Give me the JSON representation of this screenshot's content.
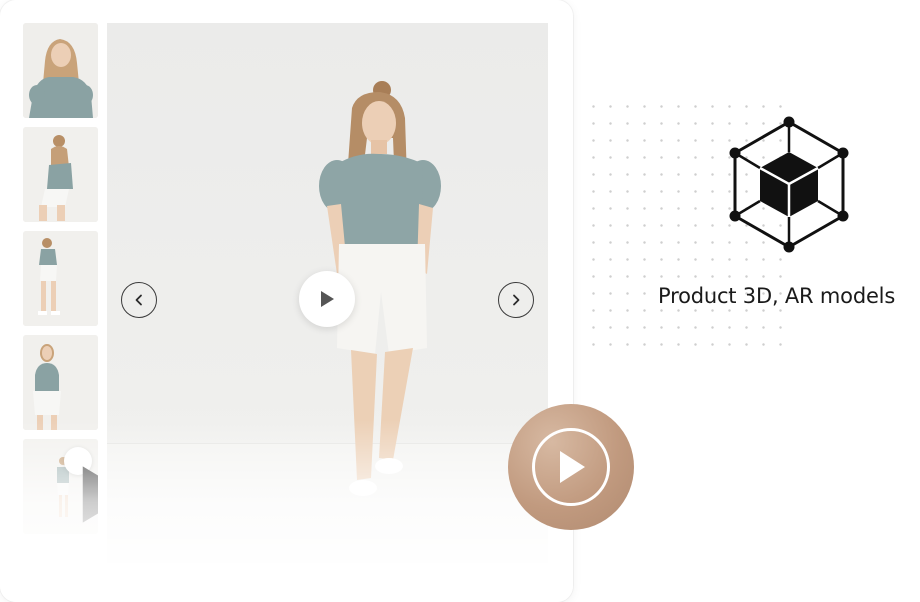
{
  "gallery": {
    "thumbnails": [
      {
        "label": "thumbnail-1",
        "type": "image"
      },
      {
        "label": "thumbnail-2",
        "type": "image"
      },
      {
        "label": "thumbnail-3",
        "type": "image"
      },
      {
        "label": "thumbnail-4",
        "type": "image"
      },
      {
        "label": "thumbnail-5",
        "type": "video"
      }
    ],
    "icons": {
      "prev": "chevron-left-icon",
      "next": "chevron-right-icon",
      "play": "play-icon"
    }
  },
  "feature": {
    "label": "Product 3D, AR models",
    "icon": "3d-cube-icon"
  },
  "colors": {
    "accent": "#c19a7f",
    "text": "#1a1a1a",
    "nav_border": "#3a3a3a",
    "dot_grid": "#cfcfcf"
  }
}
